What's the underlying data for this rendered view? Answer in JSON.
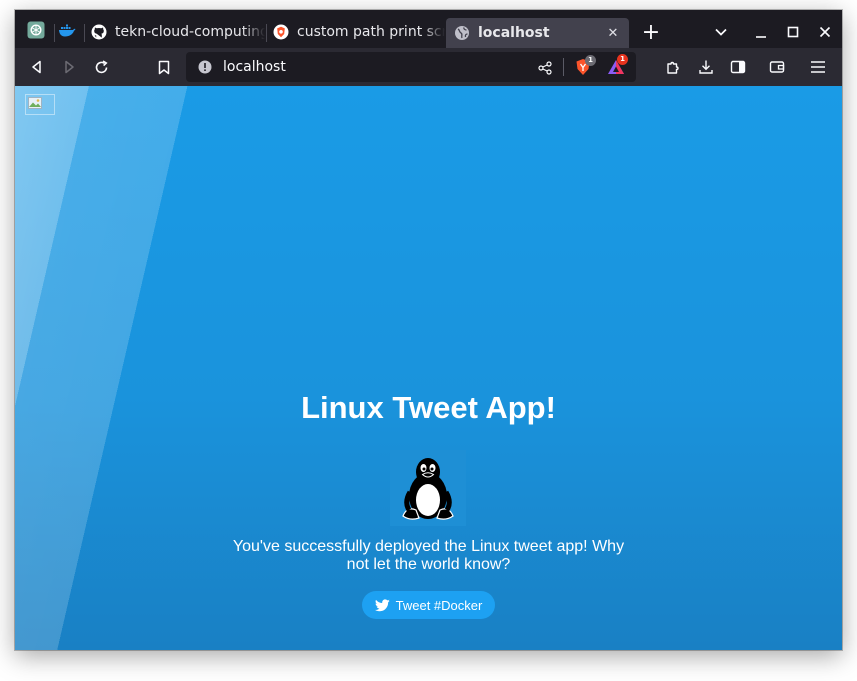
{
  "browser": {
    "pinned_tabs": [
      {
        "icon": "openai-icon"
      },
      {
        "icon": "docker-icon"
      }
    ],
    "tabs": [
      {
        "title": "tekn-cloud-computing",
        "icon": "github-icon",
        "active": false
      },
      {
        "title": "custom path print scr",
        "icon": "brave-search-icon",
        "active": false
      },
      {
        "title": "localhost",
        "icon": "globe-icon",
        "active": true
      }
    ],
    "close_glyph": "✕",
    "new_tab_glyph": "+",
    "url": "localhost",
    "shields_count": "1",
    "rewards_count": "1",
    "colors": {
      "shields": "#fb542b",
      "rewards_badge": "#e8331e",
      "frame": "#1c1b22",
      "toolbar": "#2b2a33"
    }
  },
  "page": {
    "title": "Linux Tweet App!",
    "message": "You've successfully deployed the Linux tweet app! Why not let the world know?",
    "tweet_button": "Tweet #Docker",
    "colors": {
      "background": "#1a93dc",
      "button": "#1da1f2"
    }
  }
}
